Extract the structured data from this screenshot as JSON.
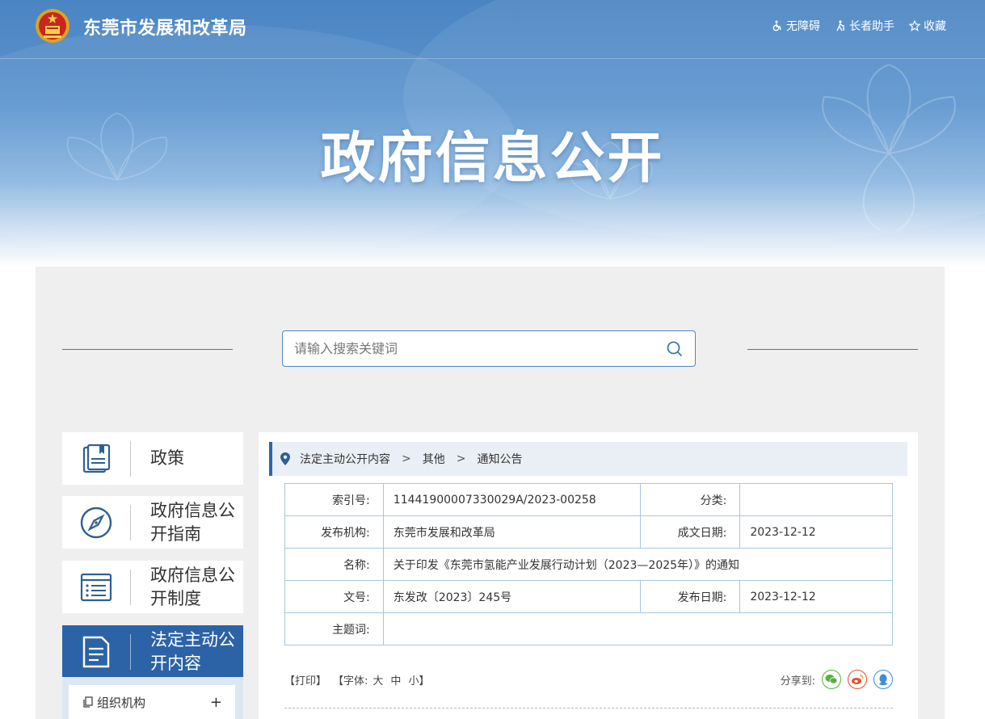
{
  "header": {
    "site_title": "东莞市发展和改革局",
    "tools": [
      {
        "label": "无障碍",
        "icon": "wheelchair-icon"
      },
      {
        "label": "长者助手",
        "icon": "elder-icon"
      },
      {
        "label": "收藏",
        "icon": "star-icon"
      }
    ]
  },
  "hero": {
    "title": "政府信息公开"
  },
  "search": {
    "placeholder": "请输入搜索关键词",
    "value": ""
  },
  "sidebar": {
    "items": [
      {
        "label": "政策",
        "icon": "policy-book-icon",
        "active": false
      },
      {
        "label": "政府信息公开指南",
        "icon": "compass-icon",
        "active": false
      },
      {
        "label": "政府信息公开制度",
        "icon": "list-icon",
        "active": false
      },
      {
        "label": "法定主动公开内容",
        "icon": "document-icon",
        "active": true
      }
    ],
    "sub_items": [
      {
        "label": "组织机构",
        "icon": "copy-icon",
        "expand": "+"
      }
    ]
  },
  "breadcrumb": {
    "items": [
      "法定主动公开内容",
      "其他",
      "通知公告"
    ],
    "separator": ">"
  },
  "meta": {
    "index_no_label": "索引号:",
    "index_no": "11441900007330029A/2023-00258",
    "category_label": "分类:",
    "category": "",
    "publisher_label": "发布机构:",
    "publisher": "东莞市发展和改革局",
    "written_date_label": "成文日期:",
    "written_date": "2023-12-12",
    "name_label": "名称:",
    "name": "关于印发《东莞市氢能产业发展行动计划（2023—2025年）》的通知",
    "doc_no_label": "文号:",
    "doc_no": "东发改〔2023〕245号",
    "publish_date_label": "发布日期:",
    "publish_date": "2023-12-12",
    "subject_label": "主题词:",
    "subject": ""
  },
  "doc_tools": {
    "print": "【打印】",
    "font_prefix": "【字体:",
    "font_large": "大",
    "font_medium": "中",
    "font_small": "小",
    "font_suffix": "】",
    "share_label": "分享到:",
    "share": [
      {
        "name": "wechat",
        "color": "#5aae3c"
      },
      {
        "name": "weibo",
        "color": "#e0502b"
      },
      {
        "name": "qq",
        "color": "#3b8fd6"
      }
    ]
  },
  "colors": {
    "primary": "#2c63a6",
    "accent_border": "#a7c6dc"
  }
}
